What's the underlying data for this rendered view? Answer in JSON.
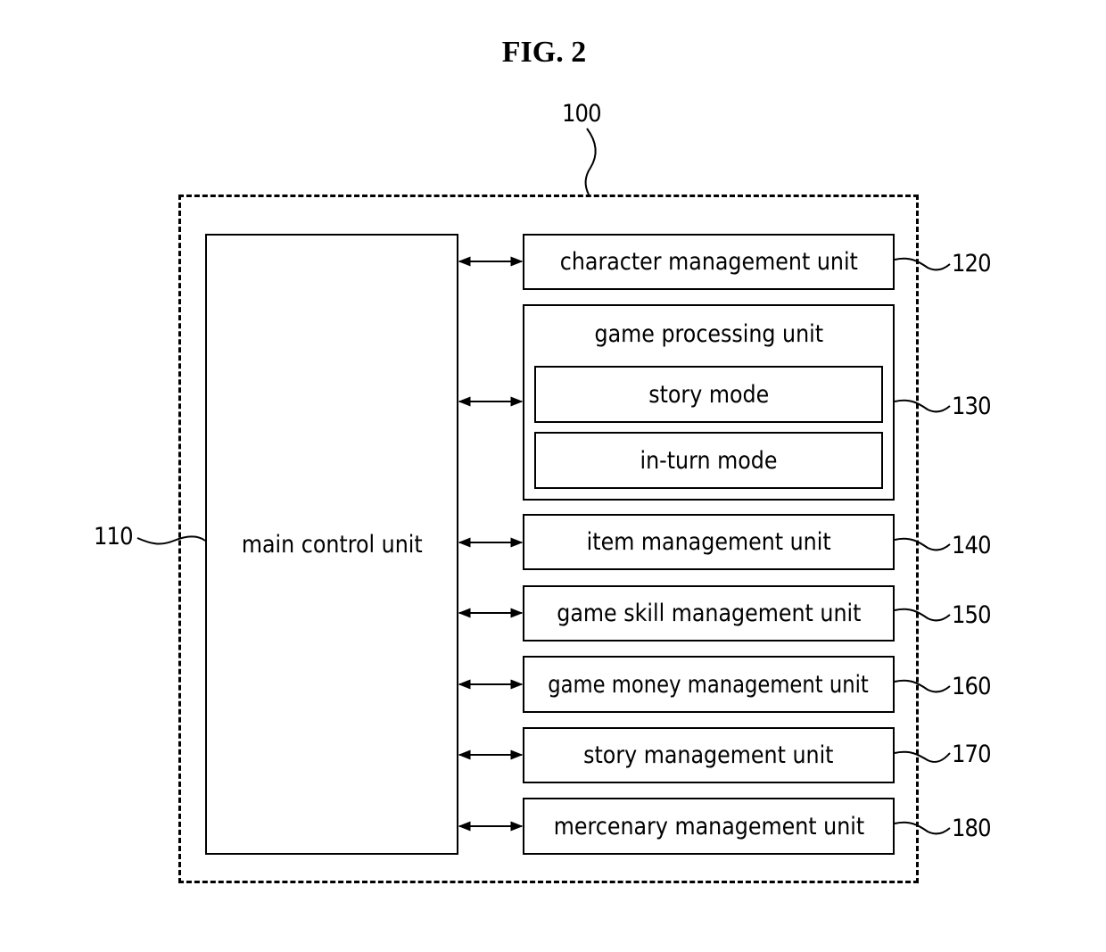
{
  "figure": {
    "title": "FIG. 2",
    "system_ref": "100"
  },
  "main_control": {
    "label": "main control unit",
    "ref": "110"
  },
  "units": [
    {
      "label": "character management unit",
      "ref": "120"
    },
    {
      "label": "game processing unit",
      "ref": "130",
      "modes": [
        "story mode",
        "in-turn mode"
      ]
    },
    {
      "label": "item management unit",
      "ref": "140"
    },
    {
      "label": "game skill management unit",
      "ref": "150"
    },
    {
      "label": "game money management unit",
      "ref": "160"
    },
    {
      "label": "story management unit",
      "ref": "170"
    },
    {
      "label": "mercenary management unit",
      "ref": "180"
    }
  ]
}
